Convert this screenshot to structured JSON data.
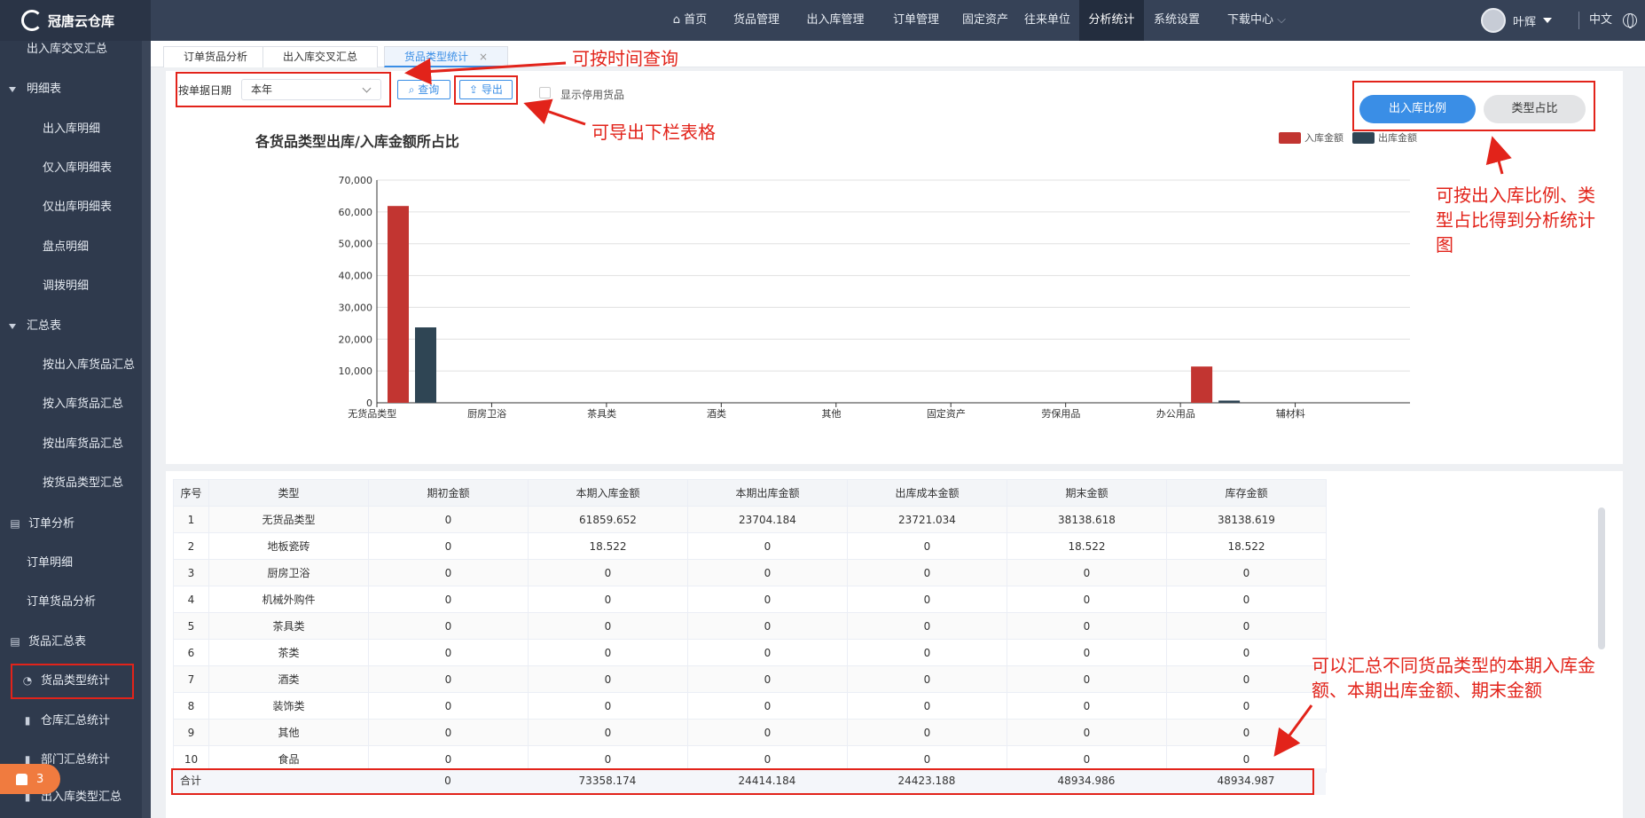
{
  "app": {
    "title": "冠唐云仓库"
  },
  "topnav": {
    "items": [
      "首页",
      "货品管理",
      "出入库管理",
      "订单管理",
      "固定资产",
      "往来单位",
      "分析统计",
      "系统设置",
      "下载中心"
    ],
    "active": "分析统计",
    "user": "叶辉",
    "lang": "中文"
  },
  "sidebar": {
    "items": [
      {
        "label": "出入库交叉汇总",
        "level": "lvl1"
      },
      {
        "label": "明细表",
        "level": "group"
      },
      {
        "label": "出入库明细",
        "level": "lvl2"
      },
      {
        "label": "仅入库明细表",
        "level": "lvl2"
      },
      {
        "label": "仅出库明细表",
        "level": "lvl2"
      },
      {
        "label": "盘点明细",
        "level": "lvl2"
      },
      {
        "label": "调拨明细",
        "level": "lvl2"
      },
      {
        "label": "汇总表",
        "level": "group"
      },
      {
        "label": "按出入库货品汇总",
        "level": "lvl2"
      },
      {
        "label": "按入库货品汇总",
        "level": "lvl2"
      },
      {
        "label": "按出库货品汇总",
        "level": "lvl2"
      },
      {
        "label": "按货品类型汇总",
        "level": "lvl2"
      },
      {
        "label": "订单分析",
        "level": "group-icon"
      },
      {
        "label": "订单明细",
        "level": "lvl1"
      },
      {
        "label": "订单货品分析",
        "level": "lvl1"
      },
      {
        "label": "货品汇总表",
        "level": "group-icon"
      },
      {
        "label": "货品类型统计",
        "level": "active"
      },
      {
        "label": "仓库汇总统计",
        "level": "icon"
      },
      {
        "label": "部门汇总统计",
        "level": "icon"
      },
      {
        "label": "出入库类型汇总",
        "level": "icon"
      }
    ],
    "badge_count": "3"
  },
  "tabs": [
    {
      "label": "订单货品分析"
    },
    {
      "label": "出入库交叉汇总"
    },
    {
      "label": "货品类型统计",
      "close": "×"
    }
  ],
  "filters": {
    "date_label": "按单据日期",
    "date_value": "本年",
    "query_label": "查询",
    "export_label": "导出",
    "show_disabled_label": "显示停用货品"
  },
  "toggle": {
    "ratio_label": "出入库比例",
    "type_label": "类型占比"
  },
  "chart_data": {
    "type": "bar",
    "title": "各货品类型出库/入库金额所占比",
    "categories": [
      "无货品类型",
      "厨房卫浴",
      "茶具类",
      "酒类",
      "其他",
      "固定资产",
      "劳保用品",
      "办公用品",
      "辅材料"
    ],
    "series": [
      {
        "name": "入库金额",
        "color": "#c23531",
        "values": [
          61859.652,
          0,
          0,
          0,
          0,
          0,
          0,
          11400,
          0
        ]
      },
      {
        "name": "出库金额",
        "color": "#2f4554",
        "values": [
          23704.184,
          0,
          0,
          0,
          0,
          0,
          0,
          700,
          0
        ]
      }
    ],
    "ylim": [
      0,
      70000
    ],
    "yticks": [
      "70,000",
      "60,000",
      "50,000",
      "40,000",
      "30,000",
      "20,000",
      "10,000",
      "0"
    ],
    "legend": "top-right",
    "grid": true
  },
  "table": {
    "headers": [
      "序号",
      "类型",
      "期初金额",
      "本期入库金额",
      "本期出库金额",
      "出库成本金额",
      "期末金额",
      "库存金额"
    ],
    "rows": [
      [
        "1",
        "无货品类型",
        "0",
        "61859.652",
        "23704.184",
        "23721.034",
        "38138.618",
        "38138.619"
      ],
      [
        "2",
        "地板瓷砖",
        "0",
        "18.522",
        "0",
        "0",
        "18.522",
        "18.522"
      ],
      [
        "3",
        "厨房卫浴",
        "0",
        "0",
        "0",
        "0",
        "0",
        "0"
      ],
      [
        "4",
        "机械外购件",
        "0",
        "0",
        "0",
        "0",
        "0",
        "0"
      ],
      [
        "5",
        "茶具类",
        "0",
        "0",
        "0",
        "0",
        "0",
        "0"
      ],
      [
        "6",
        "茶类",
        "0",
        "0",
        "0",
        "0",
        "0",
        "0"
      ],
      [
        "7",
        "酒类",
        "0",
        "0",
        "0",
        "0",
        "0",
        "0"
      ],
      [
        "8",
        "装饰类",
        "0",
        "0",
        "0",
        "0",
        "0",
        "0"
      ],
      [
        "9",
        "其他",
        "0",
        "0",
        "0",
        "0",
        "0",
        "0"
      ],
      [
        "10",
        "食品",
        "0",
        "0",
        "0",
        "0",
        "0",
        "0"
      ]
    ],
    "total": [
      "合计",
      "",
      "0",
      "73358.174",
      "24414.184",
      "24423.188",
      "48934.986",
      "48934.987"
    ]
  },
  "annotations": {
    "time_query": "可按时间查询",
    "export_table": "可导出下栏表格",
    "ratio_chart": [
      "可按出入库比例、类",
      "型占比得到分析统计",
      "图"
    ],
    "summary": [
      "可以汇总不同货品类型的本期入库金",
      "额、本期出库金额、期末金额"
    ]
  }
}
